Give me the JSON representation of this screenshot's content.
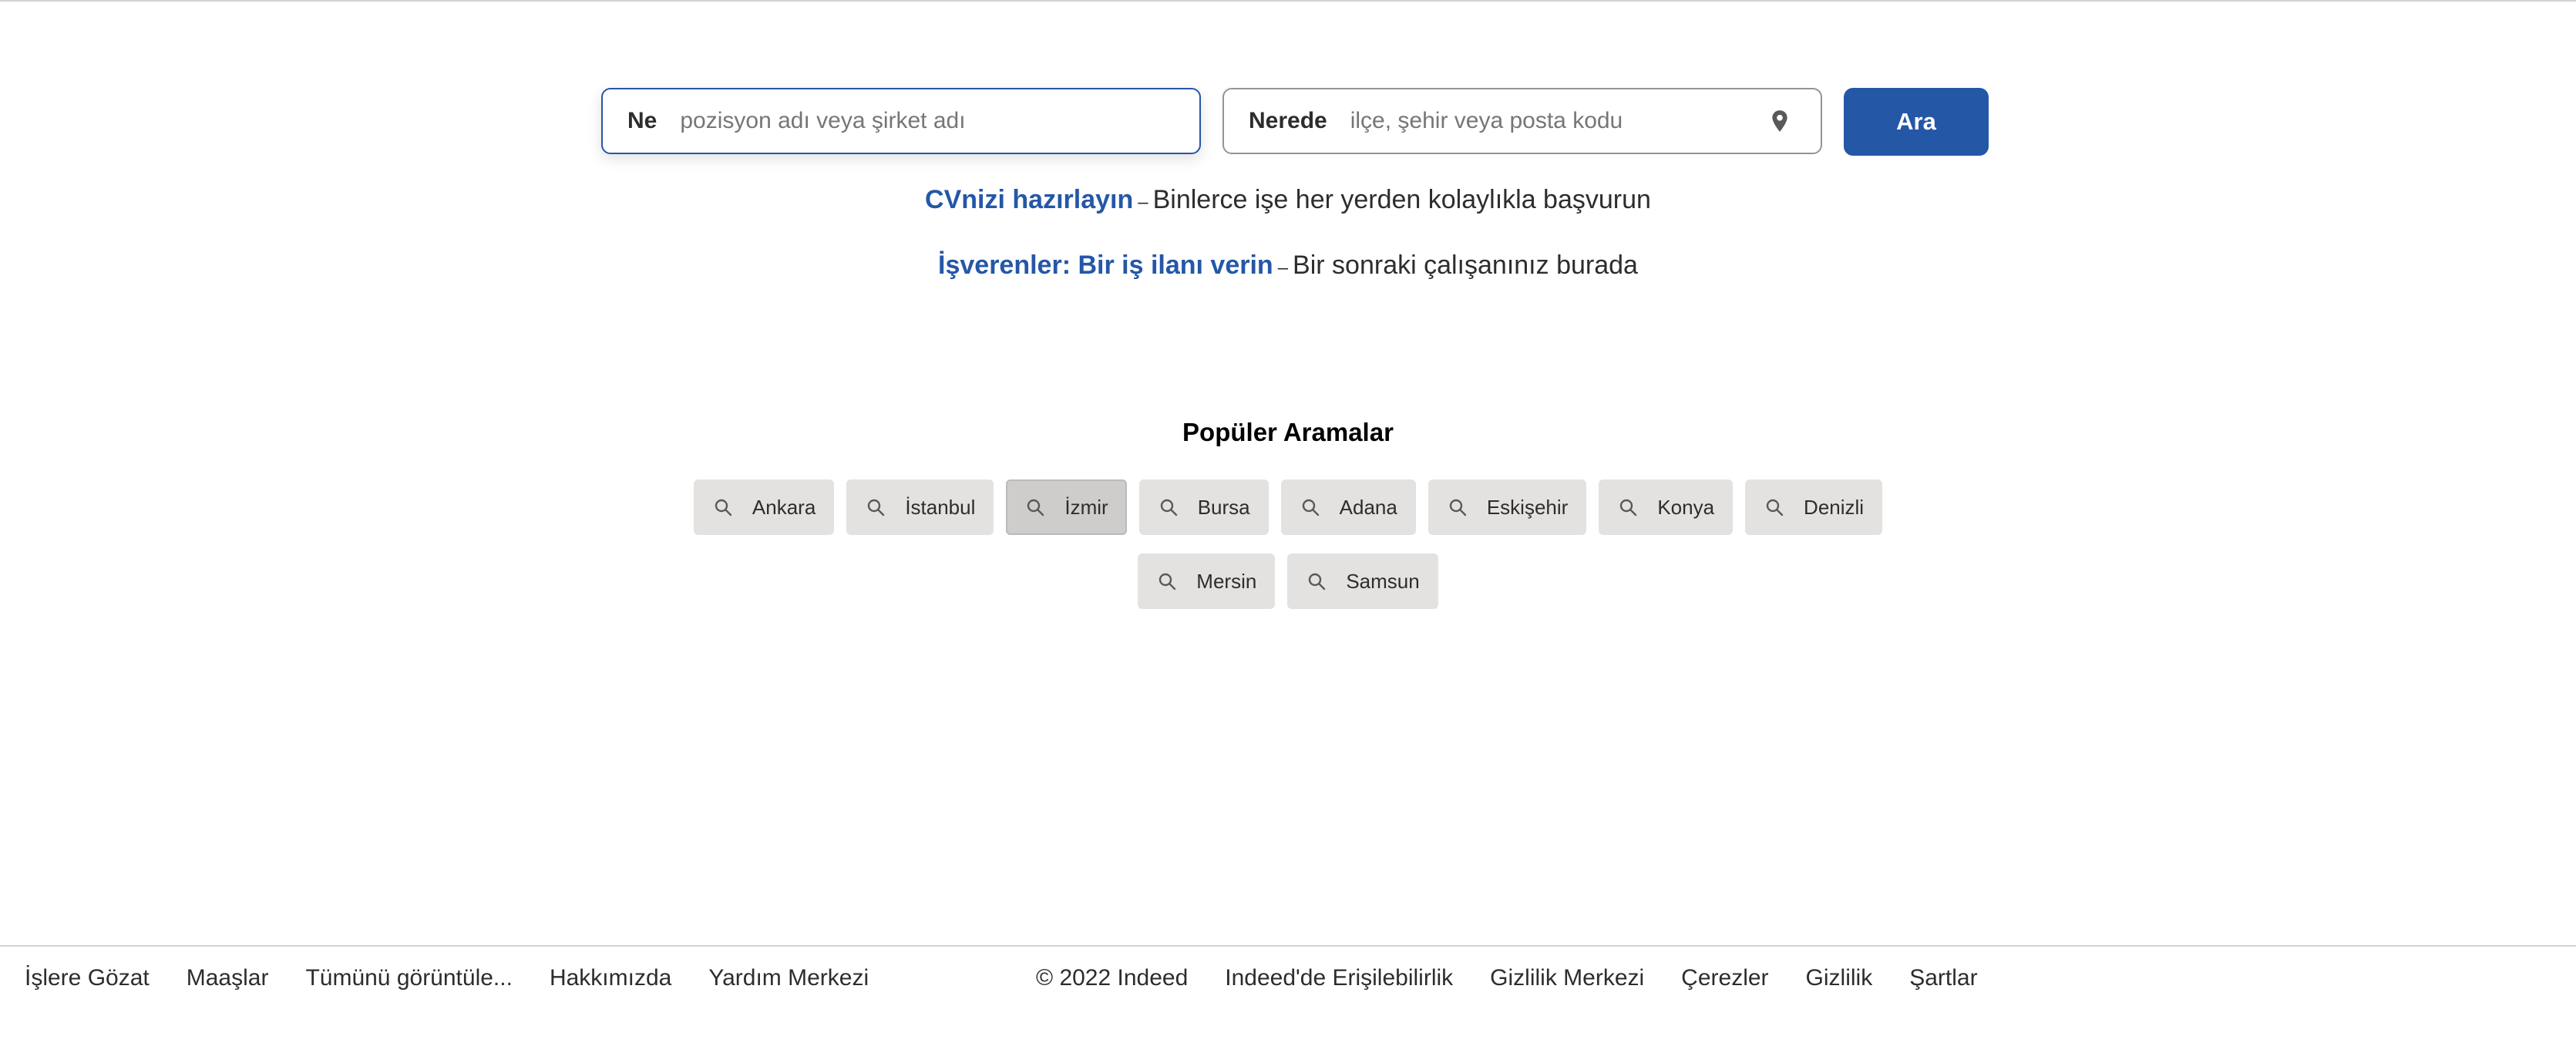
{
  "search": {
    "what_label": "Ne",
    "what_placeholder": "pozisyon adı veya şirket adı",
    "what_value": "",
    "where_label": "Nerede",
    "where_placeholder": "ilçe, şehir veya posta kodu",
    "where_value": "",
    "where_icon": "location-pin-icon",
    "button_label": "Ara",
    "accent_color": "#2557a7"
  },
  "promos": [
    {
      "link": "CVnizi hazırlayın",
      "separator": "–",
      "text": "Binlerce işe her yerden kolaylıkla başvurun"
    },
    {
      "link": "İşverenler: Bir iş ilanı verin",
      "separator": "–",
      "text": "Bir sonraki çalışanınız burada"
    }
  ],
  "popular": {
    "title": "Popüler Aramalar",
    "chip_icon": "search-icon",
    "items": [
      {
        "label": "Ankara"
      },
      {
        "label": "İstanbul"
      },
      {
        "label": "İzmir",
        "active": true
      },
      {
        "label": "Bursa"
      },
      {
        "label": "Adana"
      },
      {
        "label": "Eskişehir"
      },
      {
        "label": "Konya"
      },
      {
        "label": "Denizli"
      },
      {
        "label": "Mersin"
      },
      {
        "label": "Samsun"
      }
    ]
  },
  "footer": {
    "left_links": [
      "İşlere Gözat",
      "Maaşlar",
      "Tümünü görüntüle...",
      "Hakkımızda",
      "Yardım Merkezi"
    ],
    "copyright": "© 2022 Indeed",
    "right_links": [
      "Indeed'de Erişilebilirlik",
      "Gizlilik Merkezi",
      "Çerezler",
      "Gizlilik",
      "Şartlar"
    ]
  }
}
